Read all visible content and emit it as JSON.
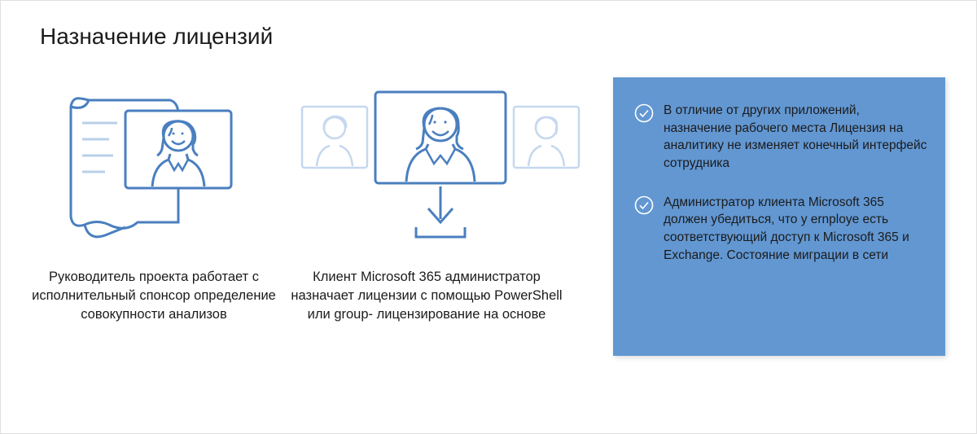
{
  "title": "Назначение лицензий",
  "captions": {
    "left": "Руководитель проекта работает с исполнительный спонсор определение совокупности анализов",
    "right": "Клиент Microsoft 365 администратор назначает лицензии с помощью PowerShell или group- лицензирование на основе"
  },
  "panel": {
    "items": [
      "В отличие от других приложений, назначение рабочего места Лицензия на аналитику не изменяет конечный интерфейс сотрудника",
      "Администратор клиента Microsoft 365 должен убедиться, что у ernploye есть соответствующий доступ к Microsoft 365 и Exchange. Состояние миграции в сети"
    ]
  },
  "colors": {
    "accent": "#6297d2",
    "stroke": "#4a7fbf",
    "lightStroke": "#b8d0e8"
  }
}
